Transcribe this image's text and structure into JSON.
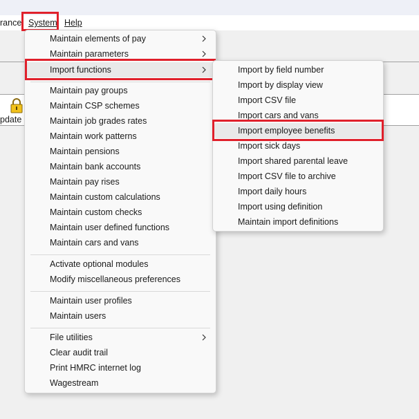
{
  "menubar": {
    "partial_left": "rance",
    "system": "System",
    "help": "Help"
  },
  "toolbar": {
    "update_partial": "pdate p"
  },
  "system_menu": {
    "items": [
      "Maintain elements of pay",
      "Maintain parameters",
      "Import functions",
      "Maintain pay groups",
      "Maintain CSP schemes",
      "Maintain job grades rates",
      "Maintain work patterns",
      "Maintain pensions",
      "Maintain bank accounts",
      "Maintain pay rises",
      "Maintain custom calculations",
      "Maintain custom checks",
      "Maintain user defined functions",
      "Maintain cars and vans",
      "Activate optional modules",
      "Modify miscellaneous preferences",
      "Maintain user profiles",
      "Maintain users",
      "File utilities",
      "Clear audit trail",
      "Print HMRC internet log",
      "Wagestream"
    ]
  },
  "import_submenu": {
    "items": [
      "Import by field number",
      "Import by display view",
      "Import CSV file",
      "Import cars and vans",
      "Import employee benefits",
      "Import sick days",
      "Import shared parental leave",
      "Import CSV file to archive",
      "Import daily hours",
      "Import using definition",
      "Maintain import definitions"
    ]
  },
  "colors": {
    "highlight_box": "#e0202b",
    "menu_bg": "#f9f9f9",
    "hover_bg": "#e9e9e9"
  },
  "icons": [
    "lock-icon",
    "chevron-right-icon"
  ]
}
